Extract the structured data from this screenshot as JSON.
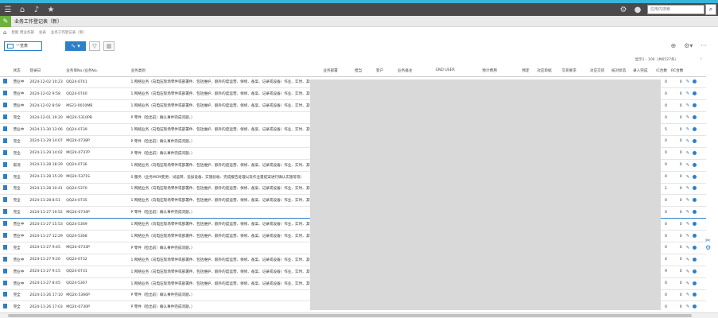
{
  "colors": {
    "accent": "#38b6d8",
    "topbar": "#4a4a4a",
    "brand_green": "#6bb33a",
    "primary_blue": "#2d7fc6"
  },
  "topbar": {
    "icons": [
      "menu-icon",
      "home-icon",
      "bell-icon",
      "star-icon"
    ],
    "search_placeholder": "应用内搜索",
    "right_icons": [
      "settings-icon",
      "user-icon",
      "search-icon"
    ]
  },
  "header": {
    "app_badge_icon": "pencil-icon",
    "title": "业务工作登记表（新）"
  },
  "breadcrumb": {
    "items": [
      "智能 用业务部",
      "总表",
      "业务工作登记表（新）"
    ]
  },
  "toolbar": {
    "view_label": "一览表",
    "chart_icon": "line-chart-icon",
    "filter_icon": "filter-icon",
    "stats_icon": "bar-chart-icon",
    "right_icons": [
      "add-icon",
      "gear-icon",
      "more-icon"
    ]
  },
  "pagination": {
    "info": "显示1 - 100（共6527条）"
  },
  "table": {
    "headers": [
      "",
      "状态",
      "登录日",
      "业务单No./业务No.",
      "业务类别",
      "业务部署",
      "担当",
      "客户",
      "业务备注",
      "END USER",
      "预计费用",
      "预定",
      "对应单据",
      "交货要求",
      "对应交货",
      "核对状态",
      "录入完成",
      "IC合数",
      "RC合数",
      ""
    ],
    "rows": [
      {
        "status": "营业中",
        "date": "2024-12-02 10:23",
        "no": "QQ24-0741",
        "desc": "1  网络业务（向电压现场零件或部署件、包括维护、额外的度运营、保修、备案、记录或设备）作业、实时、其他"
      },
      {
        "status": "营业中",
        "date": "2024-12-02 9:58",
        "no": "QQ24-0740",
        "desc": "1  网络业务（向电压现场零件或部署件、包括维护、额外的度运营、保修、备案、记录或设备）作业、实时、其他"
      },
      {
        "status": "营业中",
        "date": "2024-12-02 8:58",
        "no": "MS22-0010MB",
        "desc": "1  网络业务（向电压现场零件或部署件、包括维护、额外的度运营、保修、备案、记录或设备）作业、实时、其他"
      },
      {
        "status": "完全",
        "date": "2024-12-01 19:20",
        "no": "MQ24-5310PB",
        "desc": "P  零件（检出前）确认事件完成问题、）"
      },
      {
        "status": "营业中",
        "date": "2024-11-30 13:06",
        "no": "QQ24-0739",
        "desc": "1  网络业务（向电压现场零件或部署件、包括维护、额外的度运营、保修、备案、记录或设备）作业、实时、其他"
      },
      {
        "status": "完全",
        "date": "2024-11-29 14:07",
        "no": "MQ24-0738P",
        "desc": "P  零件（检出前）确认事件完成问题、）"
      },
      {
        "status": "完全",
        "date": "2024-11-29 14:02",
        "no": "MQ24-0737P",
        "desc": "P  零件（检出前）确认事件完成问题、）"
      },
      {
        "status": "取消",
        "date": "2024-11-28 18:29",
        "no": "QQ24-0736",
        "desc": "1  网络业务（向电压现场零件或部署件、包括维护、额外的度运营、保修、备案、记录或设备）作业、实时、其他"
      },
      {
        "status": "完全",
        "date": "2024-11-28 15:29",
        "no": "MQ24-5371S",
        "desc": "S  服务（业务MCM变更、试运转、追加设备、实施验收、完成报告处理以及作业量提案进行确认实施等等）"
      },
      {
        "status": "完全",
        "date": "2024-11-28 10:41",
        "no": "QQ24-5370",
        "desc": "1  网络业务（向电压现场零件或部署件、包括维护、额外的度运营、保修、备案、记录或设备）作业、实时、其他"
      },
      {
        "status": "完全",
        "date": "2024-11-28 8:51",
        "no": "QQ24-0735",
        "desc": "1  网络业务（向电压现场零件或部署件、包括维护、额外的度运营、保修、备案、记录或设备）作业、实时、其他"
      },
      {
        "status": "完全",
        "date": "2024-11-27 19:52",
        "no": "MQ24-0734P",
        "desc": "P  零件（检出前）确认事件完成问题、）"
      },
      {
        "status": "营业中",
        "date": "2024-11-27 15:53",
        "no": "QQ24-5369",
        "desc": "1  网络业务（向电压现场零件或部署件、包括维护、额外的度运营、保修、备案、记录或设备）作业、实时、其他"
      },
      {
        "status": "营业中",
        "date": "2024-11-27 12:29",
        "no": "QQ24-5368",
        "desc": "1  网络业务（向电压现场零件或部署件、包括维护、额外的度运营、保修、备案、记录或设备）作业、实时、其他"
      },
      {
        "status": "完全",
        "date": "2024-11-27 9:45",
        "no": "MQ24-0733P",
        "desc": "P  零件（检出前）确认事件完成问题、）"
      },
      {
        "status": "营业中",
        "date": "2024-11-27 9:20",
        "no": "QQ24-0732",
        "desc": "1  网络业务（向电压现场零件或部署件、包括维护、额外的度运营、保修、备案、记录或设备）作业、实时、其他"
      },
      {
        "status": "营业中",
        "date": "2024-11-27 9:15",
        "no": "QQ24-0731",
        "desc": "1  网络业务（向电压现场零件或部署件、包括维护、额外的度运营、保修、备案、记录或设备）作业、实时、其他"
      },
      {
        "status": "营业中",
        "date": "2024-11-27 8:45",
        "no": "QQ24-5367",
        "desc": "1  网络业务（向电压现场零件或部署件、包括维护、额外的度运营、保修、备案、记录或设备）作业、实时、其他"
      },
      {
        "status": "完全",
        "date": "2024-11-26 17:10",
        "no": "MQ24-5366P",
        "desc": "P  零件（检出前）确认事件完成问题、）"
      },
      {
        "status": "完全",
        "date": "2024-11-26 17:03",
        "no": "MQ24-0730P",
        "desc": "P  零件（检出前）确认事件完成问题、）"
      }
    ],
    "ic_counts": [
      0,
      0,
      0,
      0,
      5,
      0,
      0,
      0,
      0,
      1,
      0,
      0,
      0,
      0,
      0,
      4,
      9,
      0,
      0,
      0
    ],
    "rc_counts": [
      0,
      0,
      0,
      0,
      0,
      0,
      0,
      0,
      0,
      0,
      0,
      0,
      0,
      0,
      0,
      0,
      0,
      0,
      0,
      0
    ],
    "selected_row": 11
  }
}
